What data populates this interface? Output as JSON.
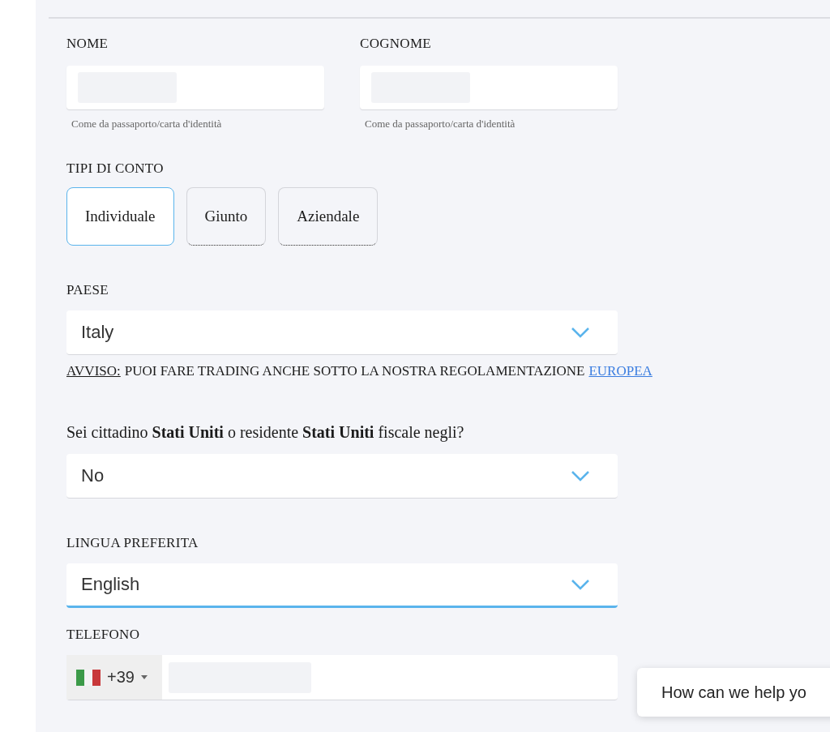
{
  "name_fields": [
    {
      "label": "NOME",
      "hint": "Come da passaporto/carta d'identità",
      "blurred": true
    },
    {
      "label": "COGNOME",
      "hint": "Come da passaporto/carta d'identità",
      "blurred": true
    }
  ],
  "account_types": {
    "label": "TIPI DI CONTO",
    "options": [
      {
        "label": "Individuale",
        "selected": true
      },
      {
        "label": "Giunto",
        "selected": false
      },
      {
        "label": "Aziendale",
        "selected": false
      }
    ]
  },
  "country": {
    "label": "PAESE",
    "value": "Italy",
    "focused": false
  },
  "notice": {
    "label": "AVVISO:",
    "text": "PUOI FARE TRADING ANCHE SOTTO LA NOSTRA REGOLAMENTAZIONE",
    "link": "EUROPEA"
  },
  "us_question": {
    "label": "Sei cittadino **Stati Uniti** o residente **Stati Uniti** fiscale negli?",
    "value": "No",
    "focused": false
  },
  "language": {
    "label": "LINGUA PREFERITA",
    "value": "English",
    "focused": true
  },
  "phone": {
    "label": "TELEFONO",
    "dial_code": "+39",
    "blurred": true
  },
  "chat_bubble": {
    "text": "How can we help yo"
  }
}
